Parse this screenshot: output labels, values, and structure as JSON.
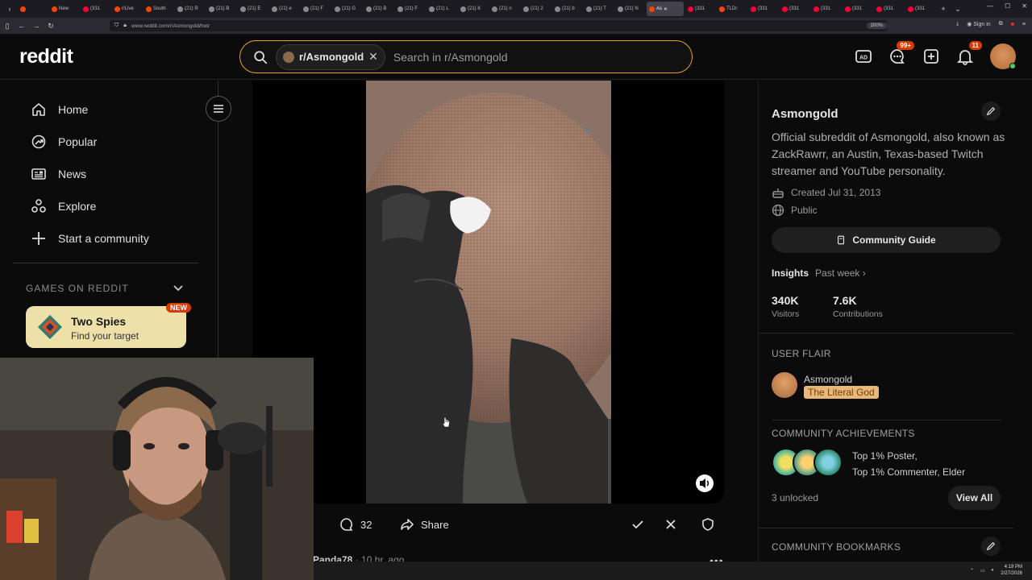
{
  "browser": {
    "tabs": [
      {
        "label": "",
        "color": "#ff4500"
      },
      {
        "label": "New",
        "color": "#ff4500"
      },
      {
        "label": "(331",
        "color": "#ff0033"
      },
      {
        "label": "r/Live",
        "color": "#ff4500"
      },
      {
        "label": "South",
        "color": "#ff4500"
      },
      {
        "label": "(21) R",
        "color": "#888888"
      },
      {
        "label": "(21) B",
        "color": "#888888"
      },
      {
        "label": "(21) E",
        "color": "#888888"
      },
      {
        "label": "(21) e",
        "color": "#888888"
      },
      {
        "label": "(21) F",
        "color": "#888888"
      },
      {
        "label": "(21) G",
        "color": "#888888"
      },
      {
        "label": "(21) B",
        "color": "#888888"
      },
      {
        "label": "(21) F",
        "color": "#888888"
      },
      {
        "label": "(21) L",
        "color": "#888888"
      },
      {
        "label": "(21) K",
        "color": "#888888"
      },
      {
        "label": "(21) n",
        "color": "#888888"
      },
      {
        "label": "(21) 2",
        "color": "#888888"
      },
      {
        "label": "(21) b",
        "color": "#888888"
      },
      {
        "label": "(21) T",
        "color": "#888888"
      },
      {
        "label": "(21) N",
        "color": "#888888"
      },
      {
        "label": "As",
        "color": "#ff4500",
        "active": true
      },
      {
        "label": "(331",
        "color": "#ff0033"
      },
      {
        "label": "TLDr",
        "color": "#ff4500"
      },
      {
        "label": "(331",
        "color": "#ff0033"
      },
      {
        "label": "(331",
        "color": "#ff0033"
      },
      {
        "label": "(331",
        "color": "#ff0033"
      },
      {
        "label": "(331",
        "color": "#ff0033"
      },
      {
        "label": "(331",
        "color": "#ff0033"
      },
      {
        "label": "(331",
        "color": "#ff0033"
      }
    ],
    "url": "www.reddit.com/r/Asmongold/hot/",
    "zoom": "200%",
    "sign_in": "Sign in"
  },
  "header": {
    "logo": "reddit",
    "search_chip": "r/Asmongold",
    "search_placeholder": "Search in r/Asmongold",
    "chat_badge": "99+",
    "notif_badge": "11"
  },
  "left_nav": {
    "items": [
      {
        "label": "Home",
        "icon": "home-icon"
      },
      {
        "label": "Popular",
        "icon": "popular-icon"
      },
      {
        "label": "News",
        "icon": "news-icon"
      },
      {
        "label": "Explore",
        "icon": "explore-icon"
      },
      {
        "label": "Start a community",
        "icon": "plus-icon"
      }
    ],
    "games_label": "GAMES ON REDDIT",
    "game": {
      "title": "Two Spies",
      "subtitle": "Find your target",
      "badge": "NEW"
    }
  },
  "post": {
    "comments": "32",
    "share": "Share",
    "next_user": "Panda78",
    "next_time": "10 hr. ago"
  },
  "community": {
    "name": "Asmongold",
    "description": "Official subreddit of Asmongold, also known as ZackRawrr, an Austin, Texas-based Twitch streamer and YouTube personality.",
    "created": "Created Jul 31, 2013",
    "visibility": "Public",
    "guide_button": "Community Guide",
    "insights_label": "Insights",
    "insights_period": "Past week",
    "visitors_num": "340K",
    "visitors_label": "Visitors",
    "contrib_num": "7.6K",
    "contrib_label": "Contributions",
    "user_flair_label": "USER FLAIR",
    "flair_user": "Asmongold",
    "flair_tag": "The Literal God",
    "achievements_label": "COMMUNITY ACHIEVEMENTS",
    "achievements_line1": "Top 1% Poster,",
    "achievements_line2": "Top 1% Commenter, Elder",
    "unlocked": "3 unlocked",
    "view_all": "View All",
    "bookmarks_label": "COMMUNITY BOOKMARKS"
  },
  "taskbar": {
    "time": "4:19 PM",
    "date": "2/27/2026"
  },
  "colors": {
    "accent": "#e8a316",
    "badge": "#d93a00",
    "flair_bg": "#e8b77a"
  }
}
